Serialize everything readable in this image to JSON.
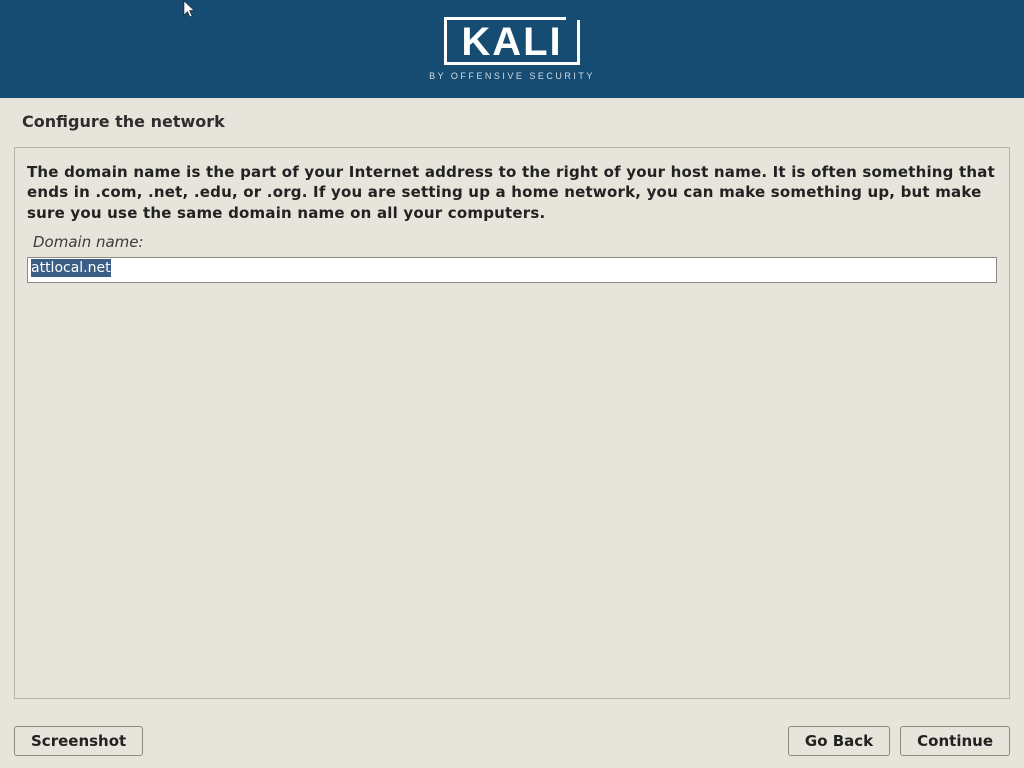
{
  "header": {
    "logo_text": "KALI",
    "logo_subtitle": "BY OFFENSIVE SECURITY"
  },
  "page": {
    "title": "Configure the network",
    "description": "The domain name is the part of your Internet address to the right of your host name.  It is often something that ends in .com, .net, .edu, or .org.  If you are setting up a home network, you can make something up, but make sure you use the same domain name on all your computers.",
    "field_label": "Domain name:",
    "field_value": "attlocal.net"
  },
  "buttons": {
    "screenshot": "Screenshot",
    "go_back": "Go Back",
    "continue": "Continue"
  }
}
